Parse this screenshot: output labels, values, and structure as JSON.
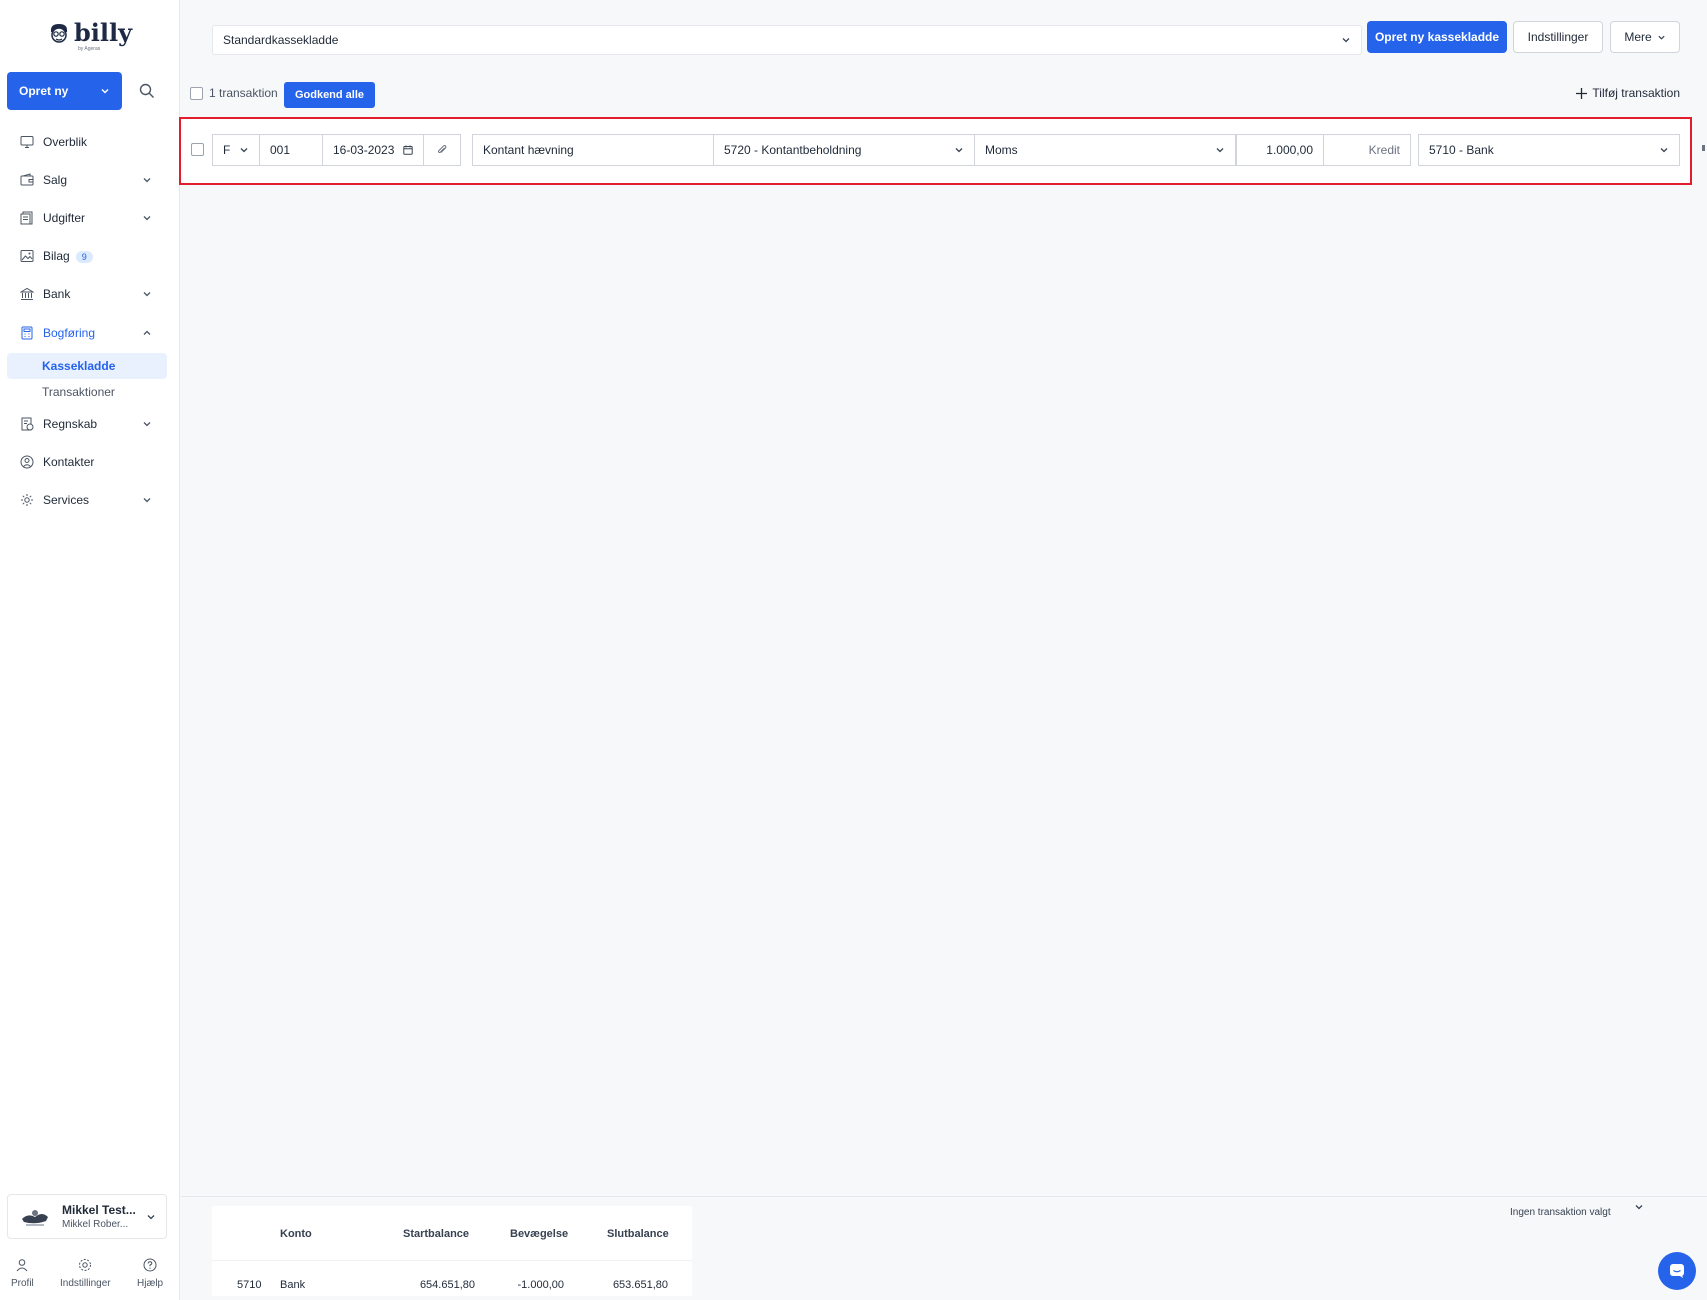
{
  "brand": {
    "name": "billy",
    "tagline": "by Ageras"
  },
  "sidebar": {
    "create_label": "Opret ny",
    "items": [
      {
        "label": "Overblik"
      },
      {
        "label": "Salg"
      },
      {
        "label": "Udgifter"
      },
      {
        "label": "Bilag",
        "badge": "9"
      },
      {
        "label": "Bank"
      },
      {
        "label": "Bogføring"
      },
      {
        "label": "Regnskab"
      },
      {
        "label": "Kontakter"
      },
      {
        "label": "Services"
      }
    ],
    "subitems": [
      {
        "label": "Kassekladde"
      },
      {
        "label": "Transaktioner"
      }
    ],
    "user": {
      "name": "Mikkel Test...",
      "org": "Mikkel Rober..."
    },
    "footer": [
      {
        "label": "Profil"
      },
      {
        "label": "Indstillinger"
      },
      {
        "label": "Hjælp"
      }
    ]
  },
  "header": {
    "journal_selected": "Standardkassekladde",
    "new_journal_label": "Opret ny kassekladde",
    "settings_label": "Indstillinger",
    "more_label": "Mere"
  },
  "toolbar": {
    "count_label": "1 transaktion",
    "approve_all_label": "Godkend alle",
    "add_tx_label": "Tilføj transaktion"
  },
  "transaction": {
    "type": "F",
    "number": "001",
    "date": "16-03-2023",
    "description": "Kontant hævning",
    "account": "5720 - Kontantbeholdning",
    "vat": "Moms",
    "amount": "1.000,00",
    "side": "Kredit",
    "contra_account": "5710 - Bank"
  },
  "balance": {
    "headers": {
      "account": "Konto",
      "start": "Startbalance",
      "movement": "Bevægelse",
      "end": "Slutbalance"
    },
    "rows": [
      {
        "number": "5710",
        "name": "Bank",
        "start": "654.651,80",
        "movement": "-1.000,00",
        "end": "653.651,80"
      }
    ],
    "no_selection": "Ingen transaktion valgt"
  },
  "colors": {
    "primary": "#2563eb",
    "highlight_border": "#e11d2e",
    "active_bg": "#e8f1fd"
  }
}
